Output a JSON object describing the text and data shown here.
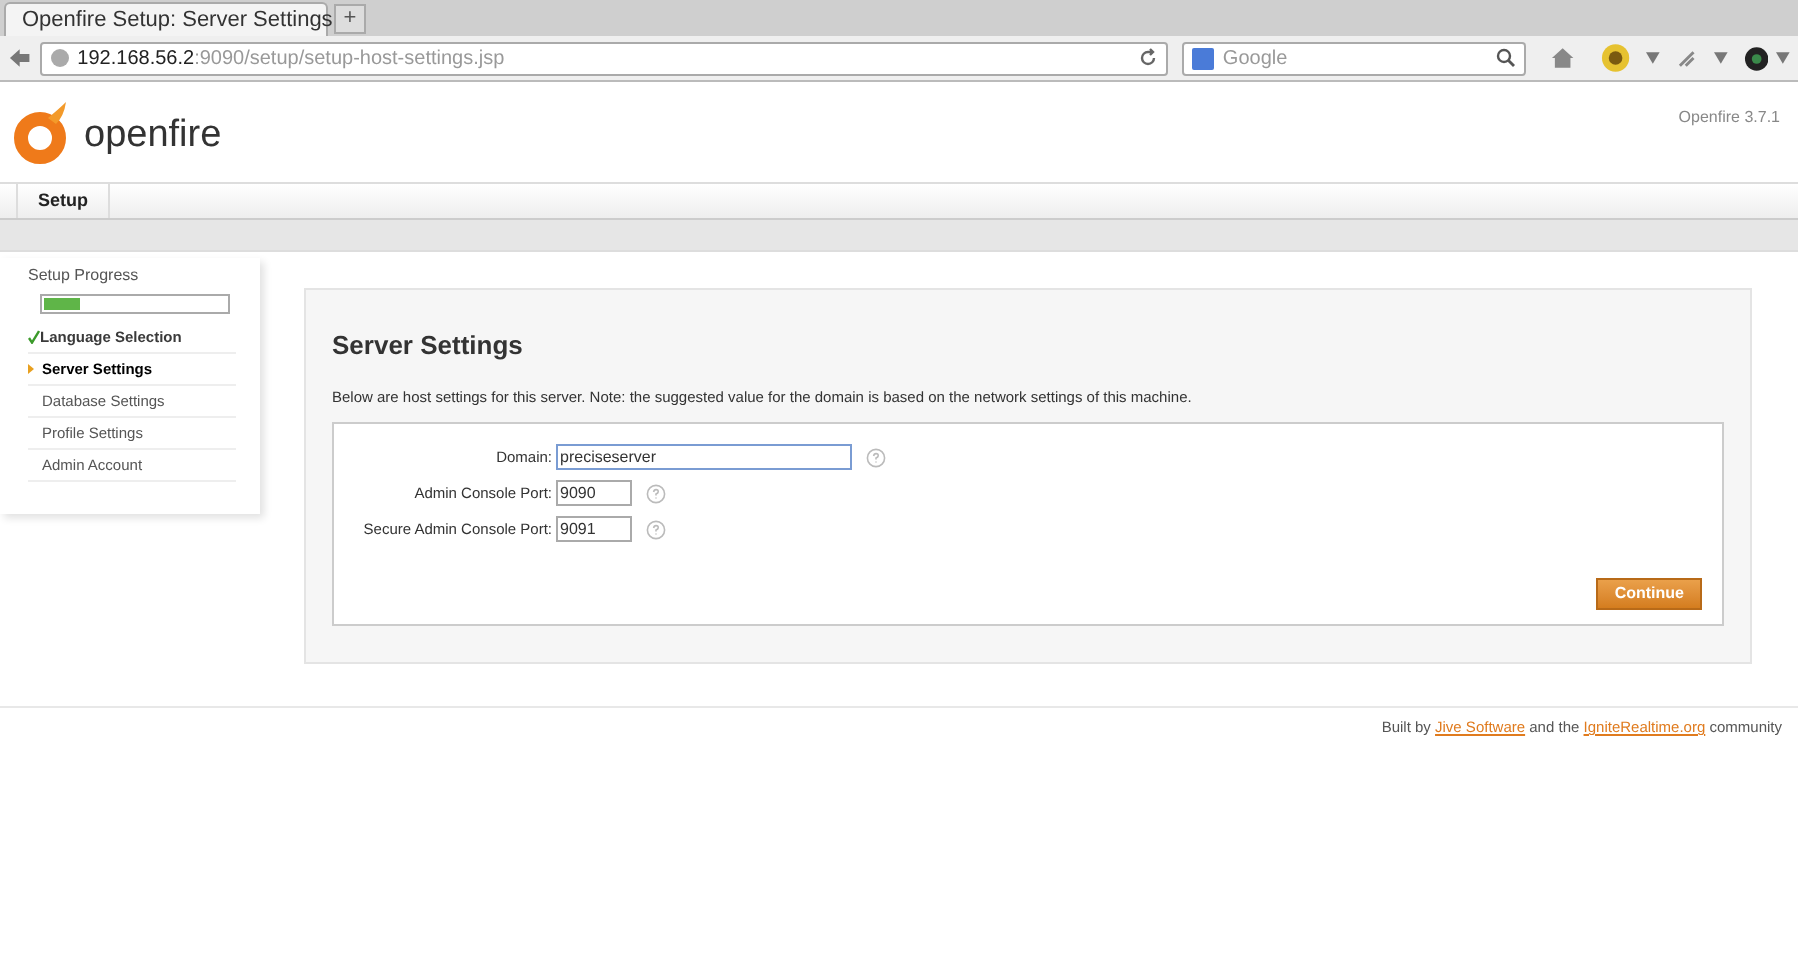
{
  "browser": {
    "tab_title": "Openfire Setup: Server Settings",
    "new_tab": "+",
    "url_host": "192.168.56.2",
    "url_path": ":9090/setup/setup-host-settings.jsp",
    "search_placeholder": "Google"
  },
  "header": {
    "logo_text": "openfire",
    "version": "Openfire 3.7.1"
  },
  "nav_tabs": [
    {
      "label": "Setup",
      "selected": true
    }
  ],
  "sidebar": {
    "title": "Setup Progress",
    "level": 0.2,
    "steps": [
      {
        "label": "Language Selection",
        "completed": true,
        "selected": false
      },
      {
        "label": "Server Settings",
        "completed": false,
        "selected": true
      },
      {
        "label": "Database Settings",
        "completed": false,
        "selected": false
      },
      {
        "label": "Profile Settings",
        "completed": false,
        "selected": false
      },
      {
        "label": "Admin Account",
        "completed": false,
        "selected": false
      }
    ]
  },
  "main": {
    "title": "Server Settings",
    "description": "Below are host settings for this server. Note: the suggested value for the domain is based on the network settings of this machine.",
    "fields": [
      {
        "label": "Domain:",
        "value": "preciseserver",
        "kind": "wide",
        "focused": true
      },
      {
        "label": "Admin Console Port:",
        "value": "9090",
        "kind": "short",
        "focused": false
      },
      {
        "label": "Secure Admin Console Port:",
        "value": "9091",
        "kind": "short",
        "focused": false
      }
    ],
    "button": "Continue"
  },
  "footer": {
    "before": "Built by",
    "link_1": "Jive Software",
    "middle": "and the",
    "link_2": "IgniteRealtime.org",
    "after": "community"
  }
}
